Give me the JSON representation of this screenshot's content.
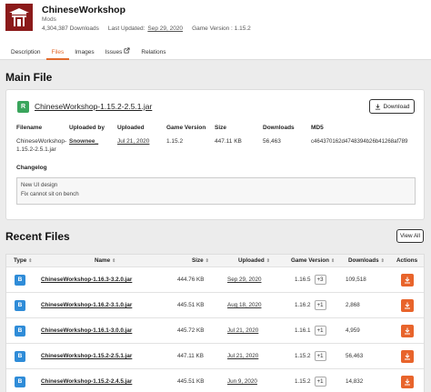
{
  "mod": {
    "title": "ChineseWorkshop",
    "category": "Mods",
    "downloads": "4,304,387 Downloads",
    "last_updated_label": "Last Updated:",
    "last_updated": "Sep 29, 2020",
    "game_version": "Game Version : 1.15.2"
  },
  "tabs": [
    {
      "label": "Description"
    },
    {
      "label": "Files"
    },
    {
      "label": "Images"
    },
    {
      "label": "Issues"
    },
    {
      "label": "Relations"
    }
  ],
  "main_file": {
    "section_title": "Main File",
    "badge": "R",
    "name": "ChineseWorkshop-1.15.2-2.5.1.jar",
    "download_label": "Download",
    "columns": {
      "filename": {
        "header": "Filename",
        "value1": "ChineseWorkshop-",
        "value2": "1.15.2-2.5.1.jar"
      },
      "uploaded_by": {
        "header": "Uploaded by",
        "value": "Snownee_"
      },
      "uploaded": {
        "header": "Uploaded",
        "value": "Jul 21, 2020"
      },
      "game_version": {
        "header": "Game Version",
        "value": "1.15.2"
      },
      "size": {
        "header": "Size",
        "value": "447.11 KB"
      },
      "downloads": {
        "header": "Downloads",
        "value": "56,463"
      },
      "md5": {
        "header": "MD5",
        "value": "c464370162d4748394b26b41268af789"
      }
    },
    "changelog_label": "Changelog",
    "changelog_lines": [
      "New UI design",
      "Fix cannot sit on bench"
    ]
  },
  "recent": {
    "section_title": "Recent Files",
    "view_all": "View All",
    "headers": {
      "type": "Type",
      "name": "Name",
      "size": "Size",
      "uploaded": "Uploaded",
      "game_version": "Game Version",
      "downloads": "Downloads",
      "actions": "Actions"
    },
    "rows": [
      {
        "type": "B",
        "name": "ChineseWorkshop-1.16.3-3.2.0.jar",
        "size": "444.76 KB",
        "uploaded": "Sep 29, 2020",
        "version": "1.16.5",
        "extra": "+3",
        "downloads": "109,518"
      },
      {
        "type": "B",
        "name": "ChineseWorkshop-1.16.2-3.1.0.jar",
        "size": "445.51 KB",
        "uploaded": "Aug 18, 2020",
        "version": "1.16.2",
        "extra": "+1",
        "downloads": "2,868"
      },
      {
        "type": "B",
        "name": "ChineseWorkshop-1.16.1-3.0.0.jar",
        "size": "445.72 KB",
        "uploaded": "Jul 21, 2020",
        "version": "1.16.1",
        "extra": "+1",
        "downloads": "4,959"
      },
      {
        "type": "B",
        "name": "ChineseWorkshop-1.15.2-2.5.1.jar",
        "size": "447.11 KB",
        "uploaded": "Jul 21, 2020",
        "version": "1.15.2",
        "extra": "+1",
        "downloads": "56,463"
      },
      {
        "type": "B",
        "name": "ChineseWorkshop-1.15.2-2.4.5.jar",
        "size": "445.51 KB",
        "uploaded": "Jun 9, 2020",
        "version": "1.15.2",
        "extra": "+1",
        "downloads": "14,832"
      }
    ]
  }
}
